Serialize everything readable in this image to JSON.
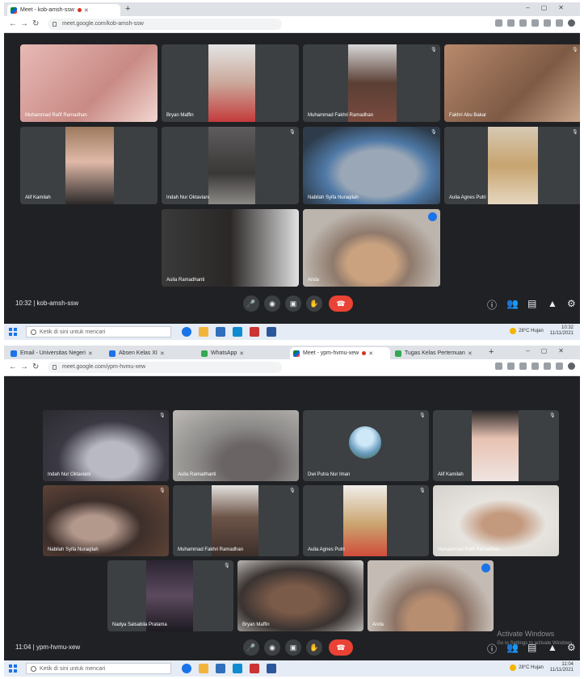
{
  "shot1": {
    "tabs": [
      {
        "label": "Meet - kob-amsh-ssw",
        "active": true
      }
    ],
    "address": "meet.google.com/kob-amsh-ssw",
    "participants": [
      "Muhammad Rafif Ramadhan",
      "Bryan Maffin",
      "Muhammad Fakhri Ramadhan",
      "Fakhri Abu Bakar",
      "Alif Kamilah",
      "Indah Nur Oktaviani",
      "Nabilah Syifa Nuraqilah",
      "Aulia Agnes Putri",
      "Aulia Ramadhanti",
      "Anda"
    ],
    "meeting_info": "10:32 | kob-amsh-ssw",
    "search_placeholder": "Ketik di sini untuk mencari",
    "tray": {
      "weather": "28°C Hujan",
      "time": "10:32",
      "date": "11/11/2021"
    }
  },
  "shot2": {
    "tabs": [
      {
        "label": "Email - Universitas Negeri",
        "active": false
      },
      {
        "label": "Absen Kelas XI",
        "active": false
      },
      {
        "label": "WhatsApp",
        "active": false
      },
      {
        "label": "Meet - ypm-hvmu-xew",
        "active": true
      },
      {
        "label": "Tugas Kelas Pertemuan",
        "active": false
      }
    ],
    "address": "meet.google.com/ypm-hvmu-xew",
    "participants": [
      "Indah Nur Oktaviani",
      "Aulia Ramadhanti",
      "Dwi Putra Nur Iman",
      "Alif Kamilah",
      "Nabilah Syifa Nuraqilah",
      "Muhammad Fakhri Ramadhan",
      "Aulia Agnes Putri",
      "Muhammad Rafif Ramadhan",
      "Nadya Salsabila Pratama",
      "Bryan Maffin",
      "Anda"
    ],
    "meeting_info": "11:04 | ypm-hvmu-xew",
    "search_placeholder": "Ketik di sini untuk mencari",
    "tray": {
      "weather": "28°C Hujan",
      "time": "11:04",
      "date": "11/11/2021"
    },
    "watermark": [
      "Activate Windows",
      "Go to Settings to activate Windows."
    ]
  },
  "colors": {
    "stage": "#202124",
    "tile": "#3c4043",
    "end_call": "#ea4335",
    "speaking": "#8ab4f8"
  },
  "controls": [
    "mic-icon",
    "camera-icon",
    "present-icon",
    "raise-hand-icon",
    "end-call-icon",
    "info-icon",
    "people-icon",
    "chat-icon",
    "activities-icon",
    "host-controls-icon"
  ]
}
